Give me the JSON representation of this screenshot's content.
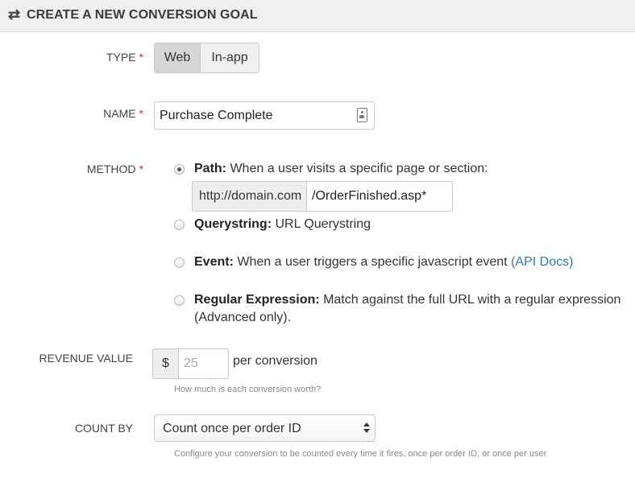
{
  "header": {
    "icon": "swap-arrows-icon",
    "icon_glyph": "⇄",
    "title": "CREATE A NEW CONVERSION GOAL"
  },
  "form": {
    "required_marker": "*",
    "type": {
      "label": "TYPE",
      "options": [
        "Web",
        "In-app"
      ],
      "selected": "Web"
    },
    "name": {
      "label": "NAME",
      "value": "Purchase Complete",
      "icon": "contact-card-icon"
    },
    "method": {
      "label": "METHOD",
      "selected": "Path",
      "options": [
        {
          "title": "Path:",
          "description": "When a user visits a specific page or section:"
        },
        {
          "title": "Querystring:",
          "description": "URL Querystring"
        },
        {
          "title": "Event:",
          "description": "When a user triggers a specific javascript event",
          "link": "(API Docs)"
        },
        {
          "title": "Regular Expression:",
          "description": "Match against the full URL with a regular expression",
          "description_line2": "(Advanced only)."
        }
      ],
      "path": {
        "domain": "http://domain.com",
        "value": "/OrderFinished.asp*"
      }
    },
    "revenue": {
      "label": "REVENUE VALUE",
      "currency": "$",
      "placeholder": "25",
      "suffix": "per conversion",
      "help": "How much is each conversion worth?"
    },
    "count_by": {
      "label": "COUNT BY",
      "selected": "Count once per order ID",
      "help": "Configure your conversion to be counted every time it fires, once per order ID, or once per user"
    }
  },
  "colors": {
    "required": "#d0342c",
    "link": "#2a7ab8",
    "header_bg": "#efefef",
    "selected_button": "#d5d5d5"
  }
}
